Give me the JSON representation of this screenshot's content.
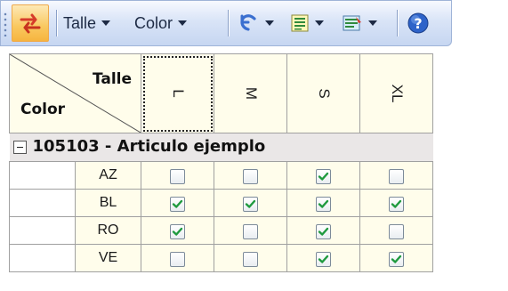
{
  "toolbar": {
    "talle_label": "Talle",
    "color_label": "Color",
    "icons": [
      "swap-rows-columns-icon",
      "undo-icon",
      "list-options-icon",
      "grid-settings-icon",
      "help-icon"
    ]
  },
  "grid": {
    "corner": {
      "column_axis": "Talle",
      "row_axis": "Color"
    },
    "columns": [
      "L",
      "M",
      "S",
      "XL"
    ],
    "selected_column": "L",
    "group": {
      "title": "105103 - Articulo ejemplo",
      "expanded": true
    },
    "rows": [
      {
        "label": "AZ",
        "checks": [
          false,
          false,
          true,
          false
        ]
      },
      {
        "label": "BL",
        "checks": [
          true,
          true,
          true,
          true
        ]
      },
      {
        "label": "RO",
        "checks": [
          true,
          false,
          true,
          false
        ]
      },
      {
        "label": "VE",
        "checks": [
          false,
          false,
          true,
          true
        ]
      }
    ]
  },
  "colors": {
    "toolbar_bg": "#d9e4f7",
    "cell_bg": "#fffdeb",
    "group_bg": "#eae7e7",
    "check_green": "#1f9a3e"
  }
}
